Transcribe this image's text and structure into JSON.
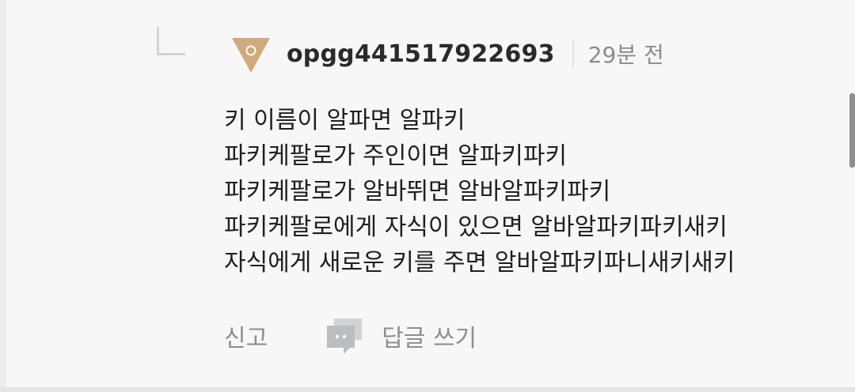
{
  "comment": {
    "username": "opgg441517922693",
    "timestamp": "29분 전",
    "avatar_icon": "tier-triangle-emblem-icon",
    "avatar_color": "#d2a97a",
    "lines": [
      "키 이름이 알파면 알파키",
      "파키케팔로가 주인이면 알파키파키",
      "파키케팔로가 알바뛰면 알바알파키파키",
      "파키케팔로에게 자식이 있으면 알바알파키파키새키",
      "자식에게 새로운 키를 주면 알바알파키파니새키새키"
    ]
  },
  "actions": {
    "report_label": "신고",
    "reply_label": "답글 쓰기",
    "reply_icon": "speech-bubble-icon"
  }
}
